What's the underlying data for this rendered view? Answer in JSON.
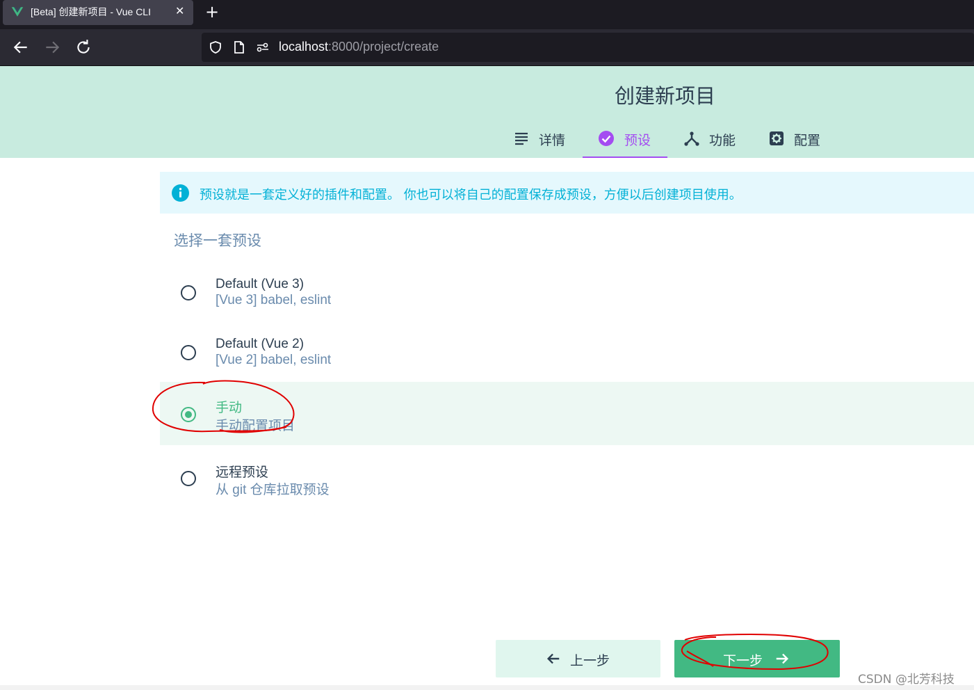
{
  "browser": {
    "tab_title": "[Beta] 创建新项目 - Vue CLI",
    "url_host": "localhost",
    "url_rest": ":8000/project/create"
  },
  "header": {
    "title": "创建新项目",
    "steps": [
      {
        "label": "详情",
        "icon": "list-icon",
        "active": false
      },
      {
        "label": "预设",
        "icon": "check-circle-icon",
        "active": true
      },
      {
        "label": "功能",
        "icon": "fork-icon",
        "active": false
      },
      {
        "label": "配置",
        "icon": "settings-icon",
        "active": false
      }
    ]
  },
  "info": {
    "text": "预设就是一套定义好的插件和配置。 你也可以将自己的配置保存成预设，方便以后创建项目使用。"
  },
  "presets": {
    "title": "选择一套预设",
    "options": [
      {
        "name": "Default (Vue 3)",
        "desc": "[Vue 3] babel, eslint",
        "selected": false
      },
      {
        "name": "Default (Vue 2)",
        "desc": "[Vue 2] babel, eslint",
        "selected": false
      },
      {
        "name": "手动",
        "desc": "手动配置项目",
        "selected": true
      },
      {
        "name": "远程预设",
        "desc": "从 git 仓库拉取预设",
        "selected": false
      }
    ]
  },
  "buttons": {
    "prev": "上一步",
    "next": "下一步"
  },
  "watermark": "CSDN @北芳科技",
  "colors": {
    "accent": "#42b983",
    "header_bg": "#c8ebdf",
    "active_step": "#a44cf1",
    "info": "#03b1d6",
    "annotation": "#e00000"
  }
}
